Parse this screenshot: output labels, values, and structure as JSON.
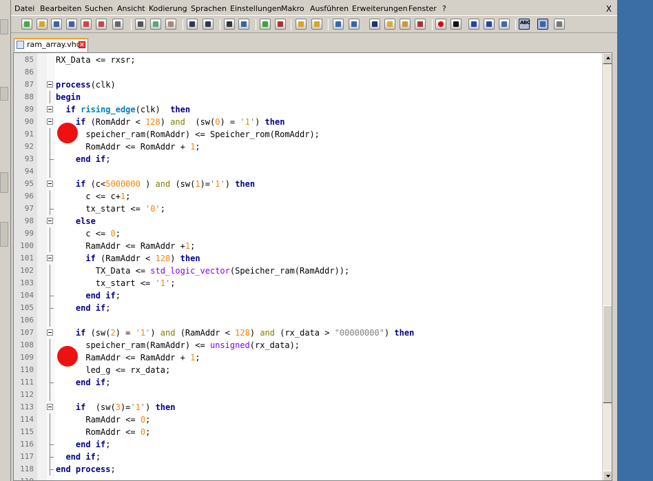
{
  "menubar": {
    "items": [
      "Datei",
      "Bearbeiten",
      "Suchen",
      "Ansicht",
      "Kodierung",
      "Sprachen",
      "Einstellungen",
      "Makro",
      "Ausführen",
      "Erweiterungen",
      "Fenster",
      "?"
    ],
    "close_label": "X"
  },
  "toolbar": {
    "icons": [
      "new-file-icon",
      "open-file-icon",
      "save-icon",
      "save-all-icon",
      "close-icon",
      "close-all-icon",
      "print-icon",
      "cut-icon",
      "copy-icon",
      "paste-icon",
      "undo-icon",
      "redo-icon",
      "find-icon",
      "replace-icon",
      "zoom-in-icon",
      "zoom-out-icon",
      "sync-vertical-icon",
      "sync-horizontal-icon",
      "word-wrap-icon",
      "show-all-chars-icon",
      "indent-guide-icon",
      "user-defined-language-icon",
      "document-map-icon",
      "function-list-icon",
      "record-macro-icon",
      "stop-record-icon",
      "play-macro-icon",
      "run-macro-multiple-icon",
      "save-macro-icon",
      "spell-check-icon",
      "panel-icon",
      "plugin-icon"
    ],
    "spell_check_text": "ABC"
  },
  "tab": {
    "label": "ram_array.vhd",
    "close_glyph": "×"
  },
  "editor": {
    "lines": [
      {
        "n": "85",
        "code": "<span>RX_Data &lt;= rxsr;</span>"
      },
      {
        "n": "86",
        "code": ""
      },
      {
        "n": "87",
        "code": "<span class=\"kw\">process</span>(clk)"
      },
      {
        "n": "88",
        "code": "<span class=\"kw\">begin</span>"
      },
      {
        "n": "89",
        "code": "  <span class=\"kw\">if</span> <span class=\"fn\">rising_edge</span>(clk)  <span class=\"kw\">then</span>"
      },
      {
        "n": "90",
        "code": "    <span class=\"kw\">if</span> (RomAddr &lt; <span class=\"num\">128</span>) <span class=\"op\">and</span>  (sw(<span class=\"num\">0</span>) = <span class=\"str\">'</span><span class=\"num\">1</span><span class=\"str\">'</span>) <span class=\"kw\">then</span>"
      },
      {
        "n": "91",
        "code": "      speicher_ram(RomAddr) &lt;= Speicher_rom(RomAddr);"
      },
      {
        "n": "92",
        "code": "      RomAddr &lt;= RomAddr + <span class=\"num\">1</span>;"
      },
      {
        "n": "93",
        "code": "    <span class=\"kw\">end if</span>;"
      },
      {
        "n": "94",
        "code": ""
      },
      {
        "n": "95",
        "code": "    <span class=\"kw\">if</span> (c&lt;<span class=\"num\">5000000</span> ) <span class=\"op\">and</span> (sw(<span class=\"num\">1</span>)=<span class=\"str\">'</span><span class=\"num\">1</span><span class=\"str\">'</span>) <span class=\"kw\">then</span>"
      },
      {
        "n": "96",
        "code": "      c &lt;= c+<span class=\"num\">1</span>;"
      },
      {
        "n": "97",
        "code": "      tx_start &lt;= <span class=\"str\">'</span><span class=\"num\">0</span><span class=\"str\">'</span>;"
      },
      {
        "n": "98",
        "code": "    <span class=\"kw\">else</span>"
      },
      {
        "n": "99",
        "code": "      c &lt;= <span class=\"num\">0</span>;"
      },
      {
        "n": "100",
        "code": "      RamAddr &lt;= RamAddr +<span class=\"num\">1</span>;"
      },
      {
        "n": "101",
        "code": "      <span class=\"kw\">if</span> (RamAddr &lt; <span class=\"num\">128</span>) <span class=\"kw\">then</span>"
      },
      {
        "n": "102",
        "code": "        TX_Data &lt;= <span class=\"typ\">std_logic_vector</span>(Speicher_ram(RamAddr));"
      },
      {
        "n": "103",
        "code": "        tx_start &lt;= <span class=\"str\">'</span><span class=\"num\">1</span><span class=\"str\">'</span>;"
      },
      {
        "n": "104",
        "code": "      <span class=\"kw\">end if</span>;"
      },
      {
        "n": "105",
        "code": "    <span class=\"kw\">end if</span>;"
      },
      {
        "n": "106",
        "code": ""
      },
      {
        "n": "107",
        "code": "    <span class=\"kw\">if</span> (sw(<span class=\"num\">2</span>) = <span class=\"str\">'</span><span class=\"num\">1</span><span class=\"str\">'</span>) <span class=\"op\">and</span> (RamAddr &lt; <span class=\"num\">128</span>) <span class=\"op\">and</span> (rx_data &gt; <span class=\"str\">\"00000000\"</span>) <span class=\"kw\">then</span>"
      },
      {
        "n": "108",
        "code": "      speicher_ram(RamAddr) &lt;= <span class=\"typ\">unsigned</span>(rx_data);"
      },
      {
        "n": "109",
        "code": "      RamAddr &lt;= RamAddr + <span class=\"num\">1</span>;"
      },
      {
        "n": "110",
        "code": "      led_g &lt;= rx_data;"
      },
      {
        "n": "111",
        "code": "    <span class=\"kw\">end if</span>;"
      },
      {
        "n": "112",
        "code": ""
      },
      {
        "n": "113",
        "code": "    <span class=\"kw\">if</span>  (sw(<span class=\"num\">3</span>)=<span class=\"str\">'</span><span class=\"num\">1</span><span class=\"str\">'</span>) <span class=\"kw\">then</span>"
      },
      {
        "n": "114",
        "code": "      RamAddr &lt;= <span class=\"num\">0</span>;"
      },
      {
        "n": "115",
        "code": "      RomAddr &lt;= <span class=\"num\">0</span>;"
      },
      {
        "n": "116",
        "code": "    <span class=\"kw\">end if</span>;"
      },
      {
        "n": "117",
        "code": "  <span class=\"kw\">end if</span>;"
      },
      {
        "n": "118",
        "code": "<span class=\"kw\">end process</span>;"
      },
      {
        "n": "119",
        "code": ""
      }
    ],
    "markers_colour": "#ee1111"
  }
}
